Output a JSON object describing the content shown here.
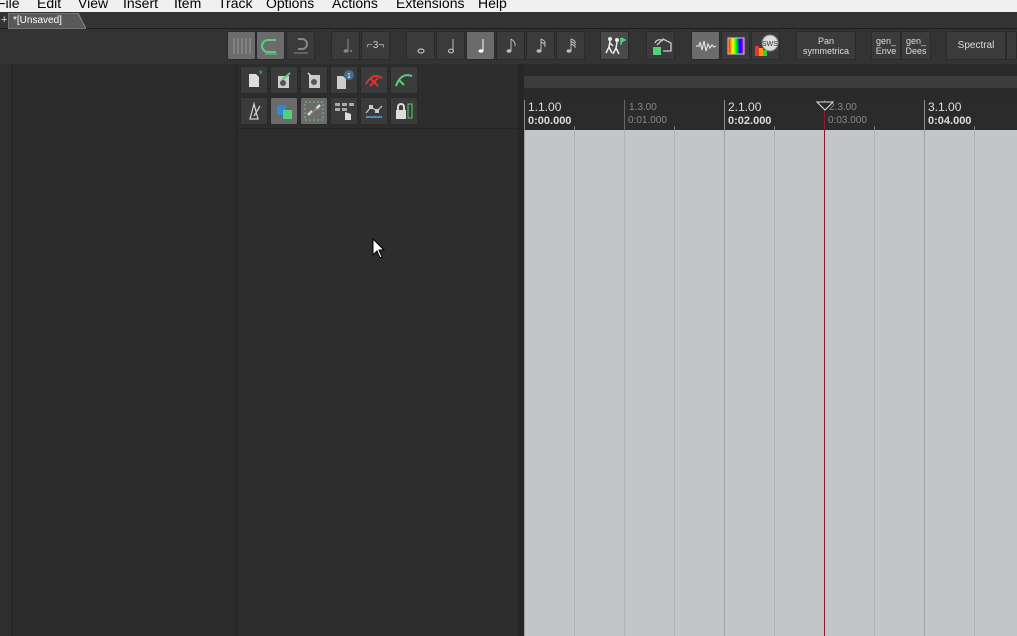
{
  "menu": [
    "File",
    "Edit",
    "View",
    "Insert",
    "Item",
    "Track",
    "Options",
    "Actions",
    "Extensions",
    "Help"
  ],
  "tabs": {
    "new_tab_symbol": "+",
    "project_tab": "*[Unsaved]"
  },
  "toolbar": {
    "pan_button": "Pan symmetrica",
    "gen_env_button": "gen_ Enve",
    "gen_dees_button": "gen_ Dees",
    "spectral_button": "Spectral",
    "triplet_label": "⌐3¬",
    "sws_label": "SWS"
  },
  "ruler": {
    "markers": [
      {
        "bar": "1.1.00",
        "time": "0:00.000",
        "major": true
      },
      {
        "bar": "1.3.00",
        "time": "0:01.000",
        "major": false
      },
      {
        "bar": "2.1.00",
        "time": "0:02.000",
        "major": true
      },
      {
        "bar": "2.3.00",
        "time": "0:03.000",
        "major": false
      },
      {
        "bar": "3.1.00",
        "time": "0:04.000",
        "major": true
      }
    ]
  },
  "colors": {
    "accent": "#55d07a",
    "background": "#2b2b2b",
    "arrange_bg": "#c3c6c8",
    "cursor": "#8a1f1f"
  }
}
